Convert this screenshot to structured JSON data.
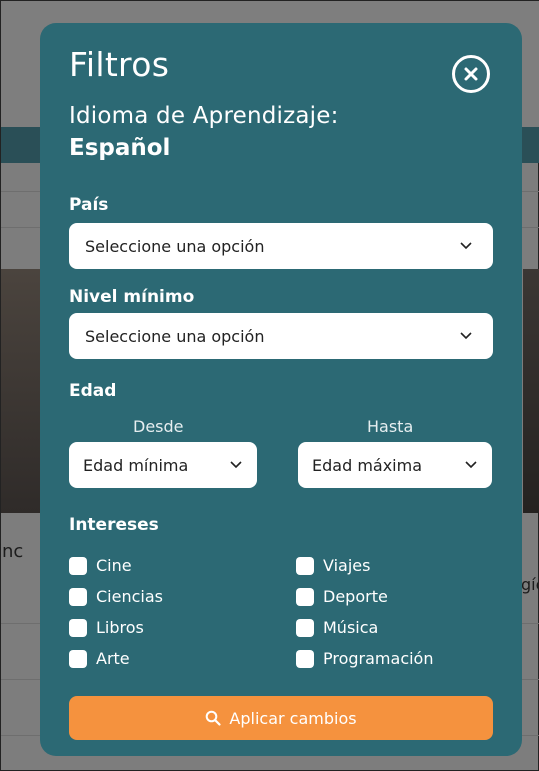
{
  "background": {
    "left_fragment": "inc",
    "right_fragment": "gíc"
  },
  "modal": {
    "title": "Filtros",
    "subtitle": "Idioma de Aprendizaje:",
    "language": "Español",
    "country": {
      "label": "País",
      "selected": "Seleccione una opción"
    },
    "min_level": {
      "label": "Nivel mínimo",
      "selected": "Seleccione una opción"
    },
    "age": {
      "label": "Edad",
      "from_label": "Desde",
      "to_label": "Hasta",
      "from_selected": "Edad mínima",
      "to_selected": "Edad máxima"
    },
    "interests": {
      "label": "Intereses",
      "left": [
        "Cine",
        "Ciencias",
        "Libros",
        "Arte"
      ],
      "right": [
        "Viajes",
        "Deporte",
        "Música",
        "Programación"
      ]
    },
    "apply_label": "Aplicar cambios"
  },
  "colors": {
    "modal_bg": "#2c6974",
    "accent": "#f5923e",
    "overlay": "#7d7d7d"
  },
  "icons": {
    "close": "close-circle-icon",
    "chevron": "chevron-down-icon",
    "search": "search-icon"
  }
}
